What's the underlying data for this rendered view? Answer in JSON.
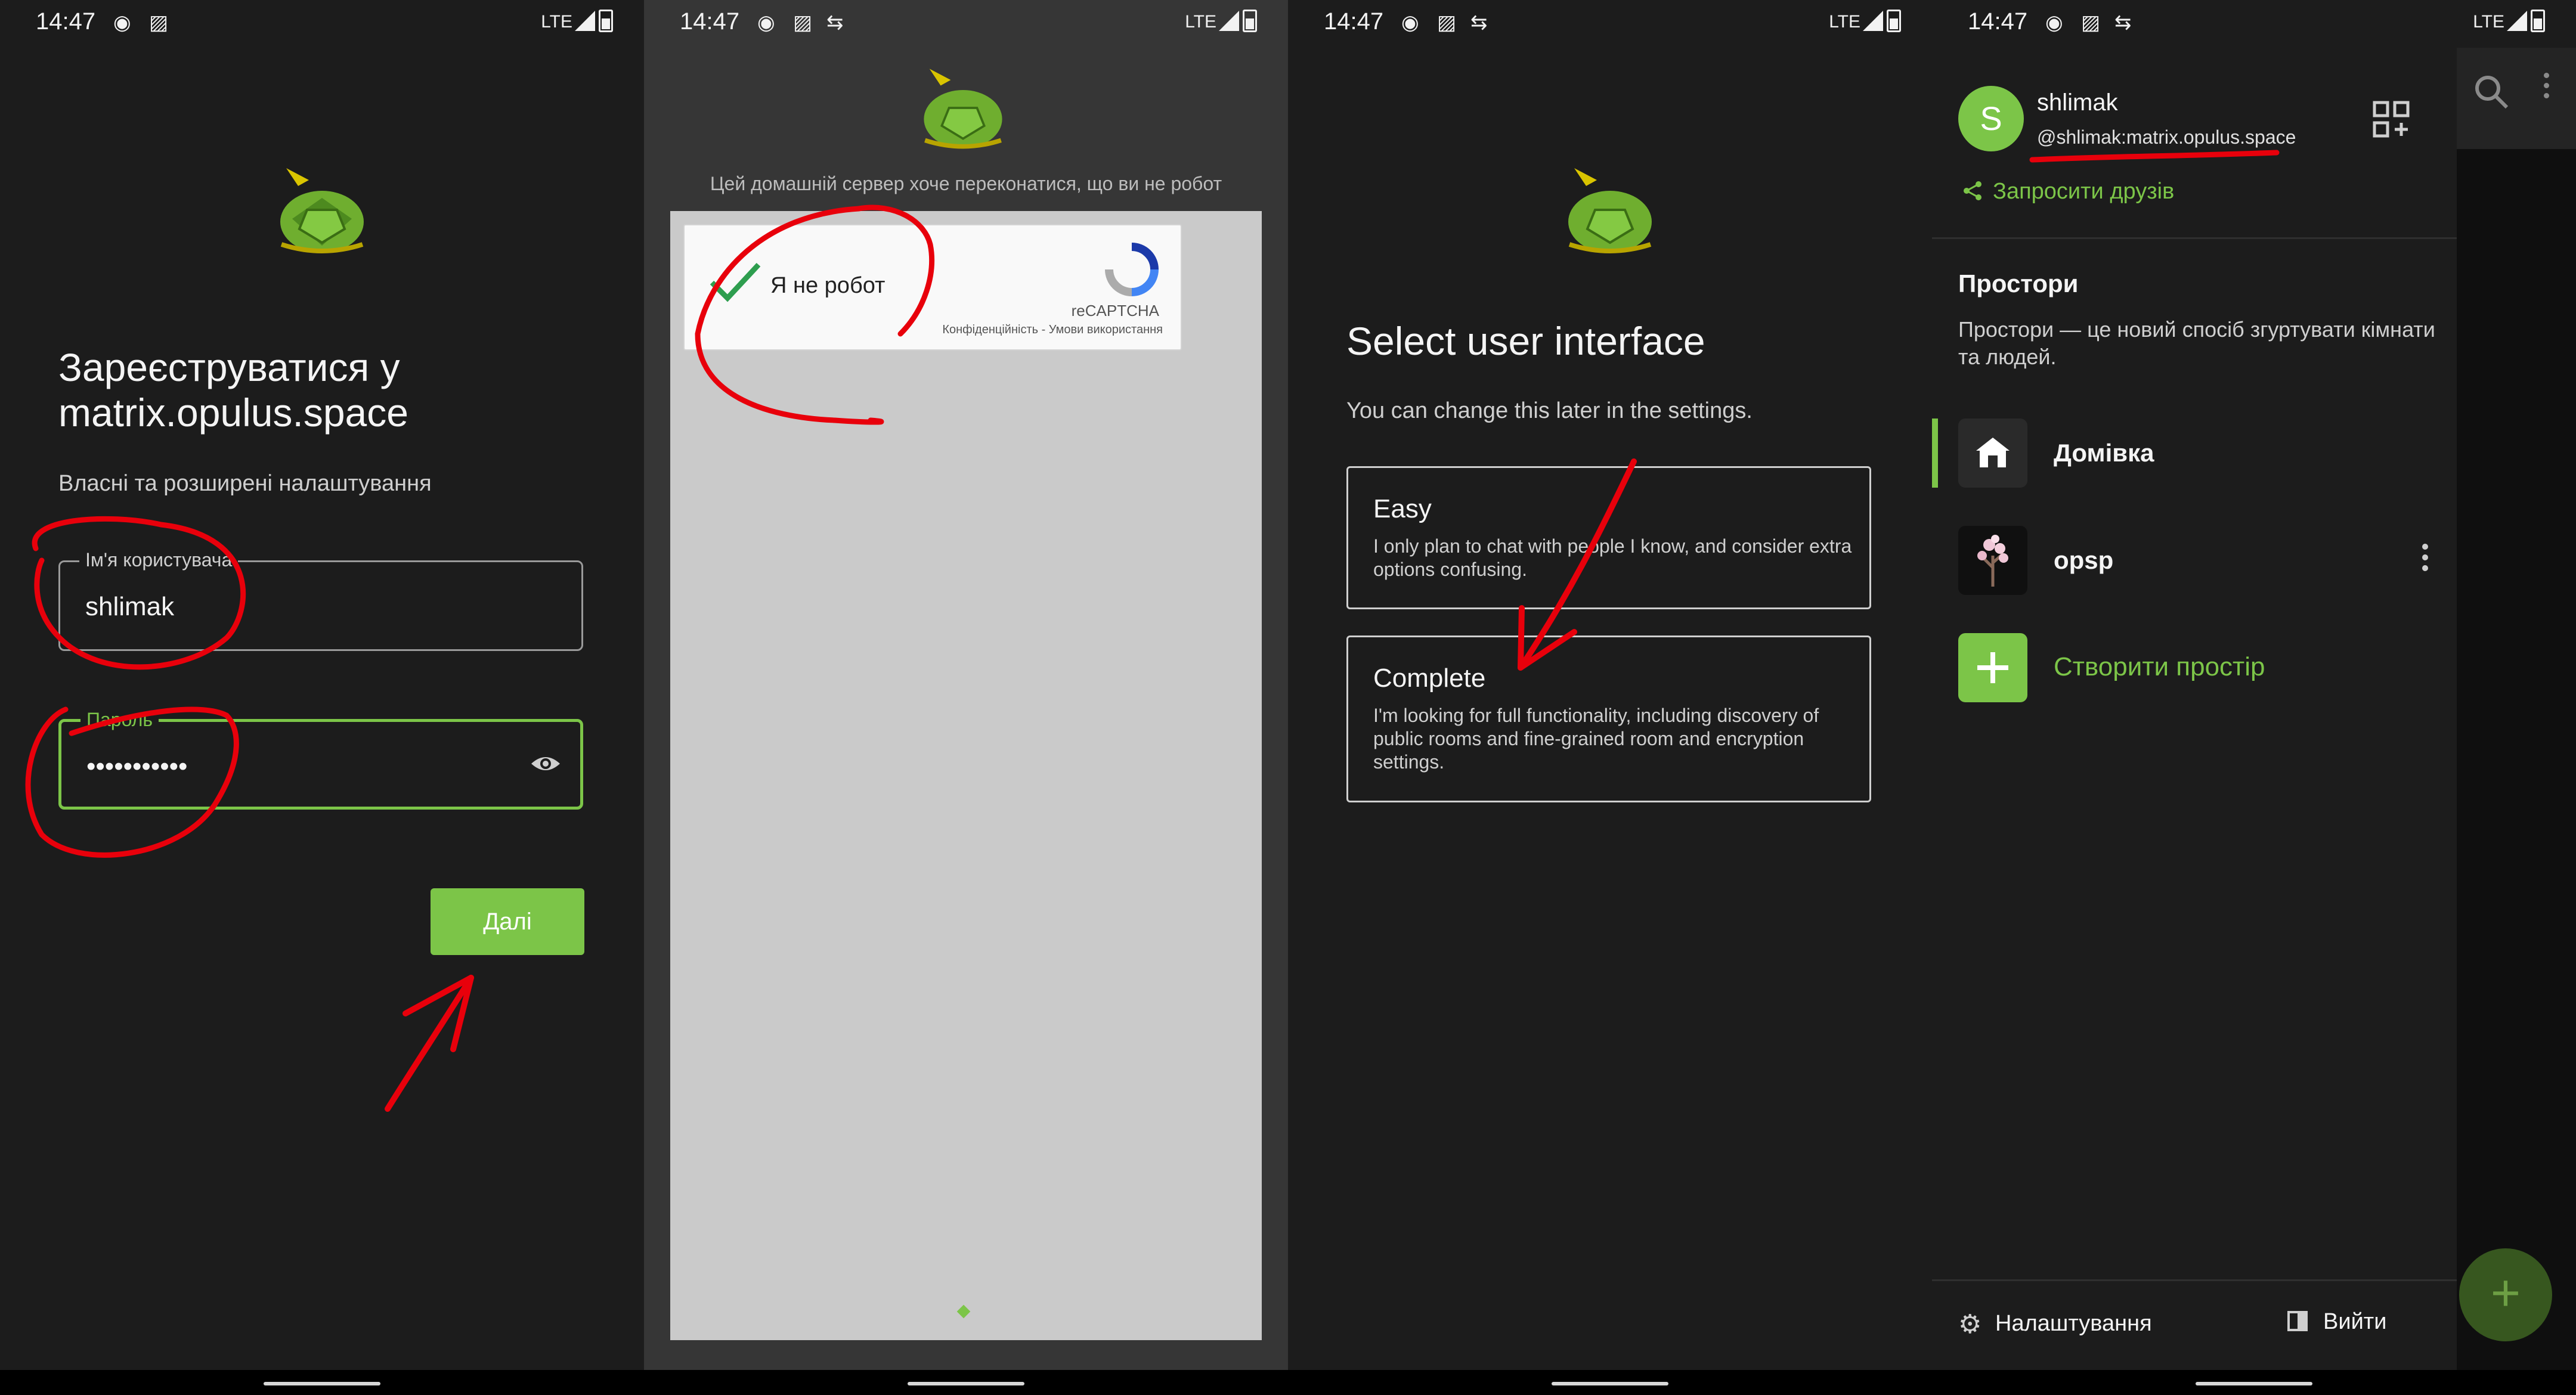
{
  "status_bar": {
    "time": "14:47",
    "network": "LTE"
  },
  "register": {
    "title_line1": "Зареєструватися у",
    "title_line2": "matrix.opulus.space",
    "subtitle": "Власні та розширені налаштування",
    "username_label": "Ім'я користувача",
    "username_value": "shlimak",
    "password_label": "Пароль",
    "password_value": "•••••••••••",
    "next_button": "Далі"
  },
  "captcha": {
    "message": "Цей домашній сервер хоче переконатися, що ви не робот",
    "checkbox_label": "Я не робот",
    "brand": "reCAPTCHA",
    "terms": "Конфіденційність - Умови використання"
  },
  "ui_select": {
    "title": "Select user interface",
    "subtitle": "You can change this later in the settings.",
    "options": [
      {
        "title": "Easy",
        "description": "I only plan to chat with people I know, and consider extra options confusing."
      },
      {
        "title": "Complete",
        "description": "I'm looking for full functionality, including discovery of public rooms and fine-grained room and encryption settings."
      }
    ]
  },
  "drawer": {
    "avatar_letter": "S",
    "username": "shlimak",
    "user_id": "@shlimak:matrix.opulus.space",
    "invite_link": "Запросити друзів",
    "spaces_title": "Простори",
    "spaces_desc": "Простори — це новий спосіб згуртувати кімнати та людей.",
    "spaces": [
      {
        "name": "Домівка",
        "icon": "home-icon"
      },
      {
        "name": "opsp",
        "icon": "tree-avatar"
      }
    ],
    "create_space": "Створити простір",
    "settings": "Налаштування",
    "logout": "Вийти"
  },
  "colors": {
    "accent": "#7cc548",
    "background": "#1c1c1c",
    "annotation": "#e8000b"
  }
}
